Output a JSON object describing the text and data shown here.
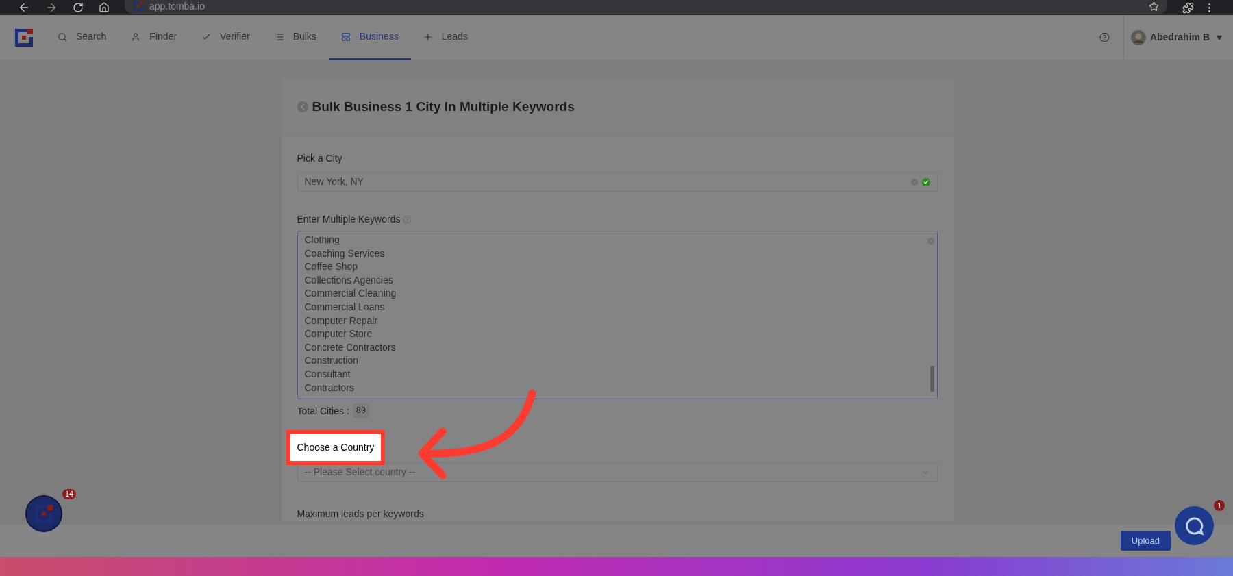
{
  "browser": {
    "url": "app.tomba.io"
  },
  "nav": {
    "items": [
      {
        "kind": "search",
        "label": "Search",
        "selected": false
      },
      {
        "kind": "finder",
        "label": "Finder",
        "selected": false
      },
      {
        "kind": "verifier",
        "label": "Verifier",
        "selected": false
      },
      {
        "kind": "bulks",
        "label": "Bulks",
        "selected": false
      },
      {
        "kind": "business",
        "label": "Business",
        "selected": true
      },
      {
        "kind": "leads",
        "label": "Leads",
        "selected": false
      }
    ],
    "user": {
      "name": "Abedrahim B"
    }
  },
  "card": {
    "title": "Bulk Business 1 City In Multiple Keywords",
    "city": {
      "label": "Pick a City",
      "value": "New York, NY",
      "valid": true
    },
    "keywords": {
      "label": "Enter Multiple Keywords",
      "lines": [
        "Clothing",
        "Coaching Services",
        "Coffee Shop",
        "Collections Agencies",
        "Commercial Cleaning",
        "Commercial Loans",
        "Computer Repair",
        "Computer Store",
        "Concrete Contractors",
        "Construction",
        "Consultant",
        "Contractors"
      ]
    },
    "total": {
      "label": "Total Cities :",
      "value": "80"
    },
    "country": {
      "label": "Choose a Country",
      "placeholder": "-- Please Select country --",
      "highlighted": true
    },
    "max_leads": {
      "label": "Maximum leads per keywords"
    }
  },
  "footer": {
    "button": "Upload"
  },
  "launcher": {
    "badge": "14"
  },
  "chat": {
    "badge": "1"
  }
}
